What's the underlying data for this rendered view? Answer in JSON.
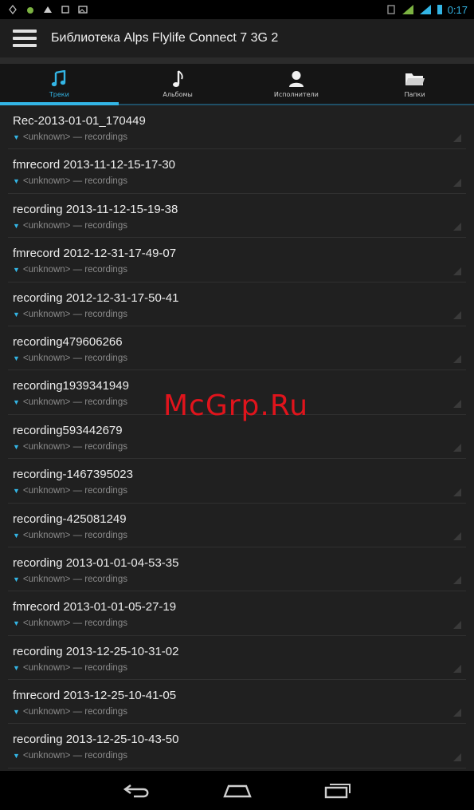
{
  "status_bar": {
    "time": "0:17"
  },
  "action_bar": {
    "title": "Библиотека Alps Flylife Connect 7 3G 2"
  },
  "tabs": [
    {
      "label": "Треки",
      "icon": "music-note-icon",
      "active": true
    },
    {
      "label": "Альбомы",
      "icon": "eighth-note-icon",
      "active": false
    },
    {
      "label": "Исполнители",
      "icon": "person-icon",
      "active": false
    },
    {
      "label": "Папки",
      "icon": "folder-icon",
      "active": false
    }
  ],
  "tracks": [
    {
      "title": "Rec-2013-01-01_170449",
      "subtitle": "<unknown> — recordings"
    },
    {
      "title": "fmrecord 2013-11-12-15-17-30",
      "subtitle": "<unknown> — recordings"
    },
    {
      "title": "recording 2013-11-12-15-19-38",
      "subtitle": "<unknown> — recordings"
    },
    {
      "title": "fmrecord 2012-12-31-17-49-07",
      "subtitle": "<unknown> — recordings"
    },
    {
      "title": "recording 2012-12-31-17-50-41",
      "subtitle": "<unknown> — recordings"
    },
    {
      "title": "recording479606266",
      "subtitle": "<unknown> — recordings"
    },
    {
      "title": "recording1939341949",
      "subtitle": "<unknown> — recordings"
    },
    {
      "title": "recording593442679",
      "subtitle": "<unknown> — recordings"
    },
    {
      "title": "recording-1467395023",
      "subtitle": "<unknown> — recordings"
    },
    {
      "title": "recording-425081249",
      "subtitle": "<unknown> — recordings"
    },
    {
      "title": "recording 2013-01-01-04-53-35",
      "subtitle": "<unknown> — recordings"
    },
    {
      "title": "fmrecord 2013-01-01-05-27-19",
      "subtitle": "<unknown> — recordings"
    },
    {
      "title": "recording 2013-12-25-10-31-02",
      "subtitle": "<unknown> — recordings"
    },
    {
      "title": "fmrecord 2013-12-25-10-41-05",
      "subtitle": "<unknown> — recordings"
    },
    {
      "title": "recording 2013-12-25-10-43-50",
      "subtitle": "<unknown> — recordings"
    }
  ],
  "watermark": "McGrp.Ru",
  "colors": {
    "accent": "#33b5e5",
    "watermark": "#e0141c"
  }
}
